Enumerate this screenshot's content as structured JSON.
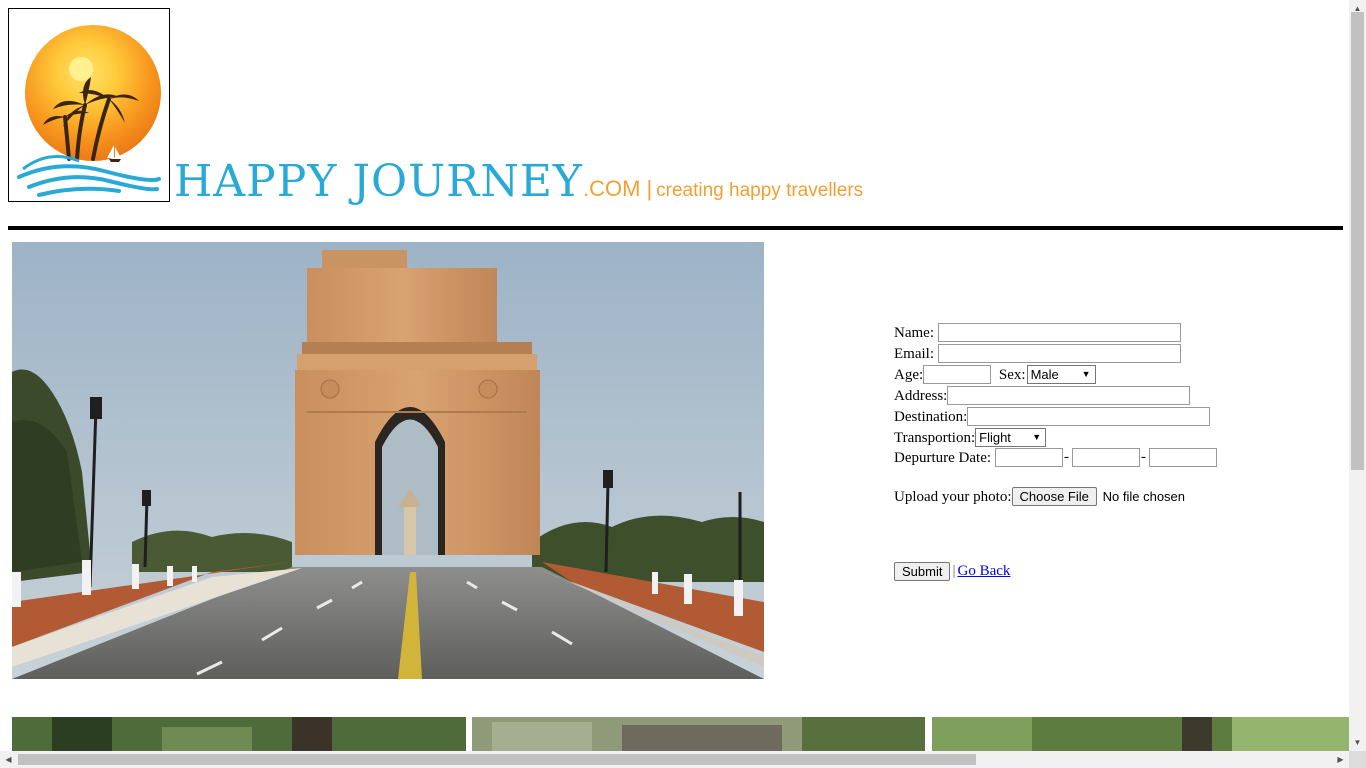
{
  "header": {
    "brand_name": "HAPPY JOURNEY",
    "brand_domain": ".COM",
    "separator": "|",
    "tagline": "creating happy travellers"
  },
  "form": {
    "name_label": "Name:",
    "email_label": "Email:",
    "age_label": "Age:",
    "sex_label": "Sex:",
    "sex_value": "Male",
    "address_label": "Address:",
    "destination_label": "Destination:",
    "transport_label": "Transportion:",
    "transport_value": "Flight",
    "date_label": "Depurture Date:",
    "date_sep": "-",
    "upload_label": "Upload your photo:",
    "choose_file": "Choose File",
    "no_file": "No file chosen",
    "submit": "Submit",
    "action_sep": "|",
    "go_back": "Go Back"
  },
  "colors": {
    "brand_blue": "#29a9d6",
    "brand_orange": "#f0a032",
    "link": "#0000ee"
  }
}
